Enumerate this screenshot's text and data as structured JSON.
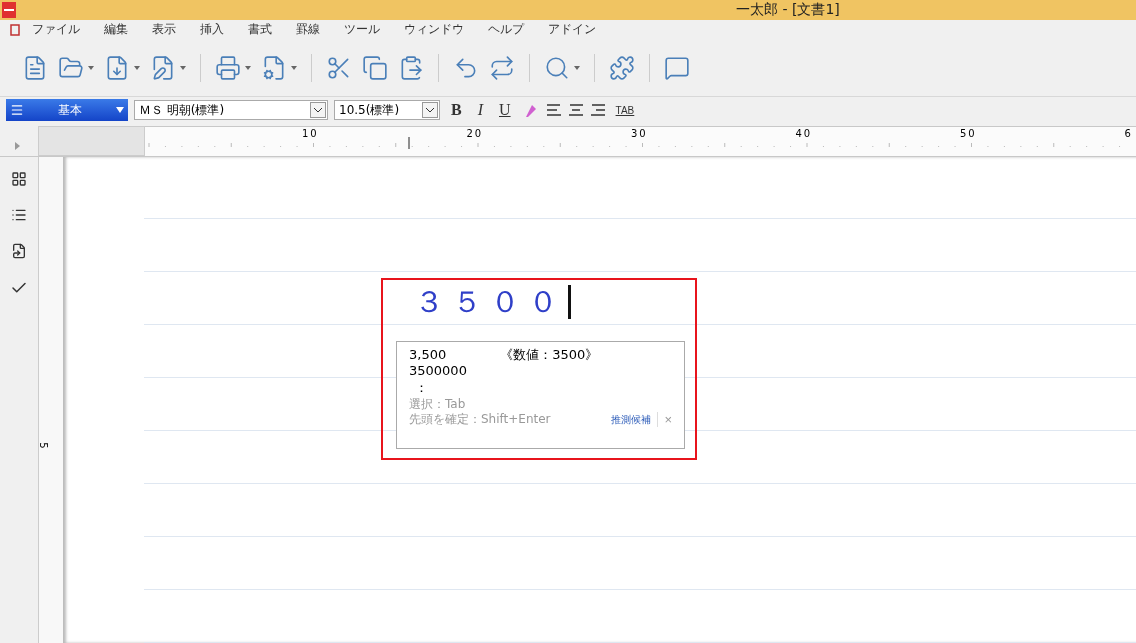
{
  "window": {
    "title": "一太郎 - [文書1]"
  },
  "menu": [
    "ファイル",
    "編集",
    "表示",
    "挿入",
    "書式",
    "罫線",
    "ツール",
    "ウィンドウ",
    "ヘルプ",
    "アドイン"
  ],
  "format_bar": {
    "style": "基本",
    "font": "ＭＳ 明朝(標準)",
    "size": "10.5(標準)",
    "buttons": [
      "B",
      "I",
      "U"
    ],
    "tab": "TAB"
  },
  "ruler": {
    "labels": [
      "10",
      "20",
      "30",
      "40",
      "50",
      "6"
    ]
  },
  "vertical_ruler": {
    "label": "5"
  },
  "document": {
    "text": "３５００"
  },
  "candidates": {
    "items": [
      {
        "value": "3,500",
        "note": "《数値：3500》"
      },
      {
        "value": "3500000"
      }
    ],
    "more": "：",
    "hints": [
      "選択：Tab",
      "先頭を確定：Shift+Enter"
    ],
    "link": "推測候補",
    "close": "×"
  }
}
